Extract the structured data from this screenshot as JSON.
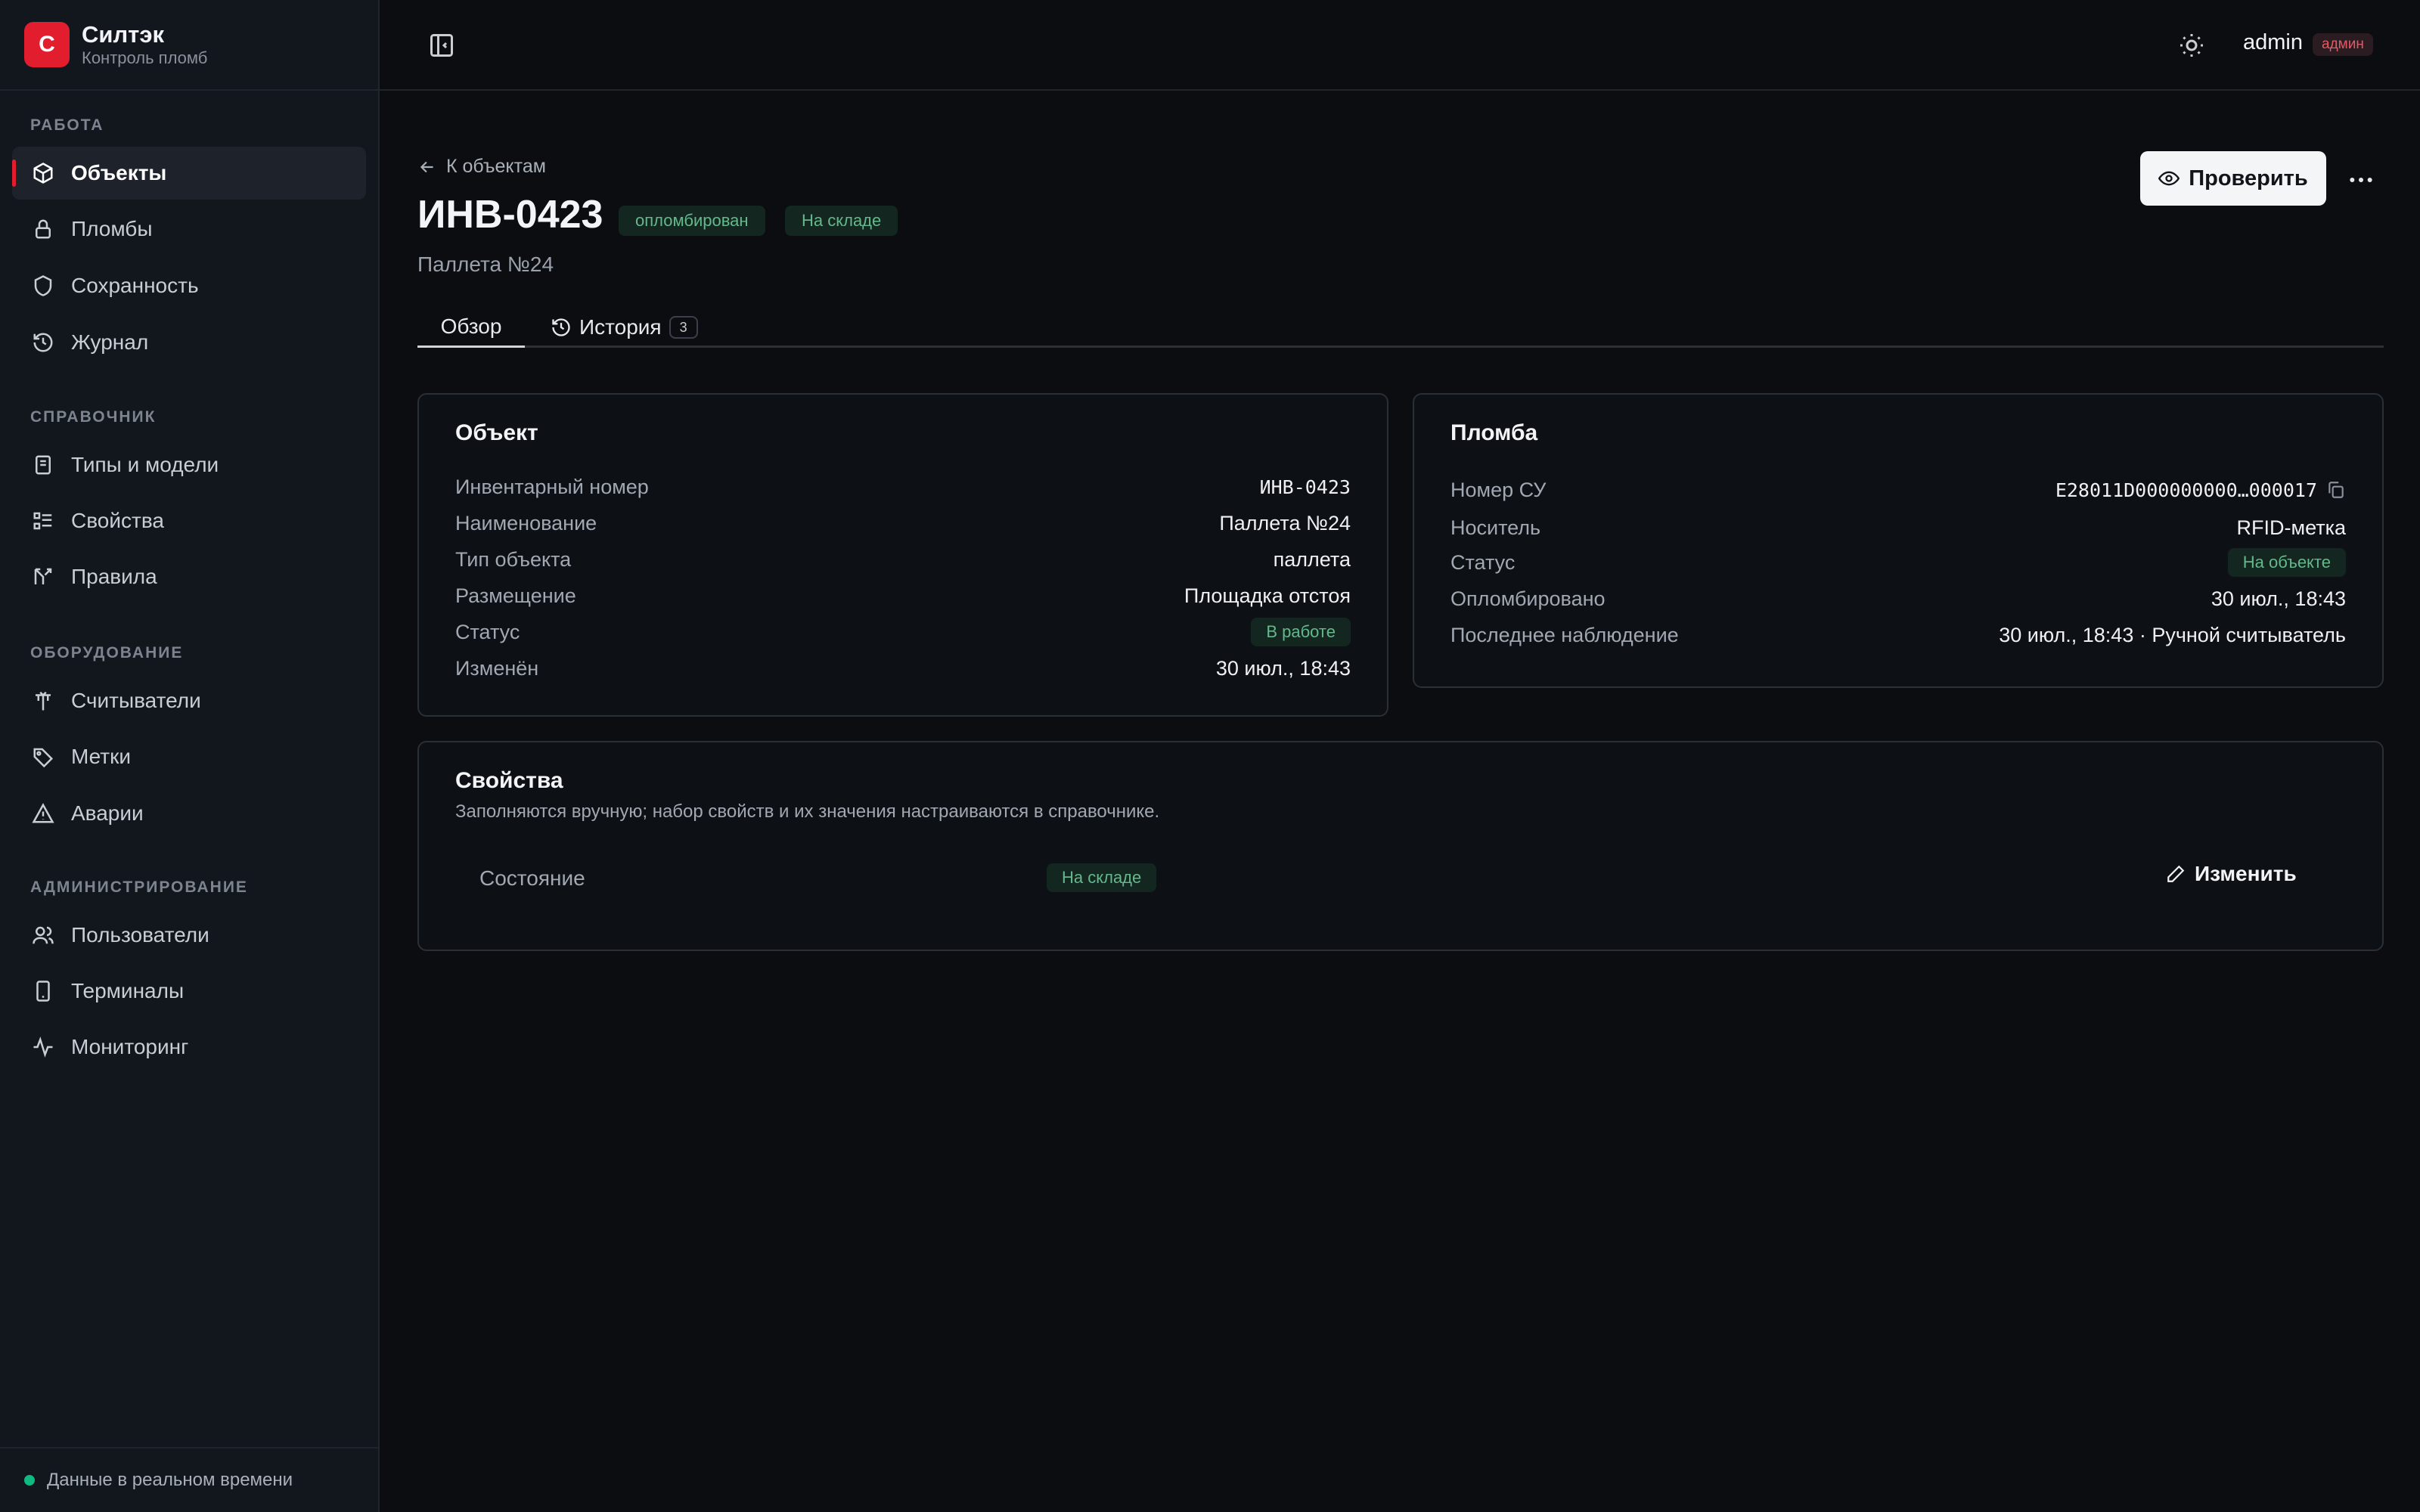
{
  "brand": {
    "logo_letter": "С",
    "name": "Силтэк",
    "subtitle": "Контроль пломб"
  },
  "sidebar": {
    "sections": [
      {
        "title": "РАБОТА",
        "items": [
          {
            "label": "Объекты",
            "icon": "box-icon",
            "active": true
          },
          {
            "label": "Пломбы",
            "icon": "lock-icon"
          },
          {
            "label": "Сохранность",
            "icon": "shield-icon"
          },
          {
            "label": "Журнал",
            "icon": "history-icon"
          }
        ]
      },
      {
        "title": "СПРАВОЧНИК",
        "items": [
          {
            "label": "Типы и модели",
            "icon": "book-icon"
          },
          {
            "label": "Свойства",
            "icon": "list-icon"
          },
          {
            "label": "Правила",
            "icon": "branch-icon"
          }
        ]
      },
      {
        "title": "ОБОРУДОВАНИЕ",
        "items": [
          {
            "label": "Считыватели",
            "icon": "antenna-icon"
          },
          {
            "label": "Метки",
            "icon": "tag-icon"
          },
          {
            "label": "Аварии",
            "icon": "warning-icon"
          }
        ]
      },
      {
        "title": "АДМИНИСТРИРОВАНИЕ",
        "items": [
          {
            "label": "Пользователи",
            "icon": "users-icon"
          },
          {
            "label": "Терминалы",
            "icon": "phone-icon"
          },
          {
            "label": "Мониторинг",
            "icon": "activity-icon"
          }
        ]
      }
    ],
    "footer": "Данные в реальном времени"
  },
  "header": {
    "user": "admin",
    "role": "админ"
  },
  "page": {
    "back_label": "К объектам",
    "title": "ИНВ-0423",
    "badges": [
      "опломбирован",
      "На складе"
    ],
    "subtitle": "Паллета №24",
    "check_label": "Проверить",
    "tabs": {
      "overview": "Обзор",
      "history": "История",
      "history_count": "3"
    }
  },
  "object_card": {
    "title": "Объект",
    "rows": [
      {
        "key": "Инвентарный номер",
        "value": "ИНВ-0423"
      },
      {
        "key": "Наименование",
        "value": "Паллета №24"
      },
      {
        "key": "Тип объекта",
        "value": "паллета"
      },
      {
        "key": "Размещение",
        "value": "Площадка отстоя"
      },
      {
        "key": "Статус",
        "value": "В работе"
      },
      {
        "key": "Изменён",
        "value": "30 июл., 18:43"
      }
    ]
  },
  "seal_card": {
    "title": "Пломба",
    "rows": [
      {
        "key": "Номер СУ",
        "value": "E28011D000000000…000017"
      },
      {
        "key": "Носитель",
        "value": "RFID-метка"
      },
      {
        "key": "Статус",
        "value": "На объекте"
      },
      {
        "key": "Опломбировано",
        "value": "30 июл., 18:43"
      },
      {
        "key": "Последнее наблюдение",
        "value": "30 июл., 18:43 · Ручной считыватель"
      }
    ]
  },
  "properties_card": {
    "title": "Свойства",
    "description": "Заполняются вручную; набор свойств и их значения настраиваются в справочнике.",
    "property_name": "Состояние",
    "property_value": "На складе",
    "edit_label": "Изменить"
  },
  "colors": {
    "accent": "#e11d2e",
    "success_text": "#64b88c",
    "success_bg": "#13261f",
    "background": "#0b0d11"
  }
}
